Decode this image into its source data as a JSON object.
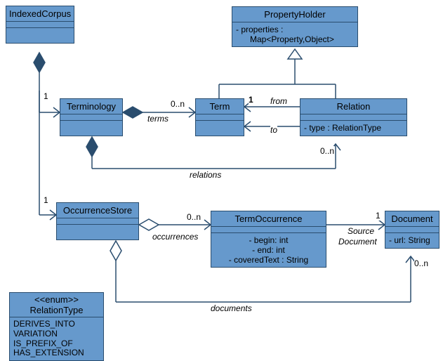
{
  "classes": {
    "IndexedCorpus": {
      "name": "IndexedCorpus"
    },
    "PropertyHolder": {
      "name": "PropertyHolder",
      "attrs": "- properties :\n      Map<Property,Object>"
    },
    "Terminology": {
      "name": "Terminology"
    },
    "Term": {
      "name": "Term"
    },
    "Relation": {
      "name": "Relation",
      "attrs": "- type : RelationType"
    },
    "OccurrenceStore": {
      "name": "OccurrenceStore"
    },
    "TermOccurrence": {
      "name": "TermOccurrence",
      "attrs_a": "- begin: int",
      "attrs_b": "- end: int",
      "attrs_c": "- coveredText : String"
    },
    "Document": {
      "name": "Document",
      "attrs": "- url: String"
    },
    "RelationType": {
      "stereotype": "<<enum>>",
      "name": "RelationType",
      "literals": "DERIVES_INTO\nVARIATION\nIS_PREFIX_OF\nHAS_EXTENSION"
    }
  },
  "labels": {
    "terms": "terms",
    "relations": "relations",
    "from": "from",
    "to": "to",
    "occurrences": "occurrences",
    "sourceDocument1": "Source",
    "sourceDocument2": "Document",
    "documents": "documents"
  },
  "mult": {
    "one_a": "1",
    "zn_terms": "0..n",
    "one_from": "1",
    "zn_rel": "0..n",
    "one_occ": "1",
    "zn_occ": "0..n",
    "one_doc": "1",
    "zn_doc": "0..n"
  }
}
